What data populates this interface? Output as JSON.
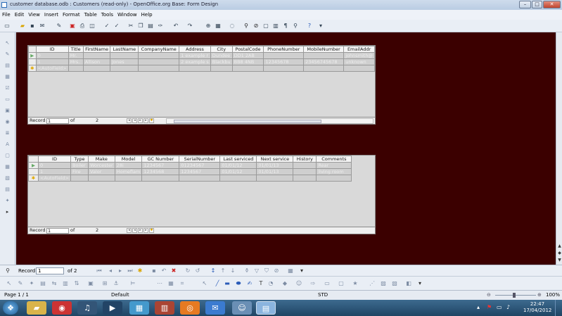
{
  "window": {
    "title": "customer database.odb : Customers (read-only) - OpenOffice.org Base: Form Design",
    "minimize": "–",
    "maximize": "□",
    "close": "✕"
  },
  "menu": [
    "File",
    "Edit",
    "View",
    "Insert",
    "Format",
    "Table",
    "Tools",
    "Window",
    "Help"
  ],
  "customers_grid": {
    "columns": [
      "ID",
      "Title",
      "FirstName",
      "LastName",
      "CompanyName",
      "Address",
      "City",
      "PostalCode",
      "PhoneNumber",
      "MobileNumber",
      "EmailAddr"
    ],
    "rows": [
      [
        "0",
        "Mr.",
        "",
        "",
        "",
        "1 example r",
        "Dundee",
        "DD1 2AB",
        "",
        "",
        "johnsmith@"
      ],
      [
        "1",
        "Mrs.",
        "Allison",
        "Jones",
        "",
        "2 example s",
        "Blackbu",
        "BB8 4NB",
        "12345678",
        "23456745678",
        "unknown"
      ]
    ],
    "new_row": "<AutoField>",
    "nav": {
      "label": "Record",
      "current": "1",
      "of_label": "of",
      "total": "2"
    }
  },
  "appliances_grid": {
    "columns": [
      "ID",
      "Type",
      "Make",
      "Model",
      "GC Number",
      "SerialNumber",
      "Last serviced",
      "Next service",
      "History",
      "Comments"
    ],
    "rows": [
      [
        "0",
        "Boiler",
        "Worcester",
        "28i",
        "1234567",
        "01234567",
        "01/01/12",
        "01/01/13",
        "",
        "Rear"
      ],
      [
        "1",
        "Fire",
        "Valor",
        "Homeflam",
        "1234568",
        "1234567",
        "01/01/12",
        "01/01/13",
        "",
        "living room"
      ]
    ],
    "new_row": "<AutoField>",
    "nav": {
      "label": "Record",
      "current": "1",
      "of_label": "of",
      "total": "2"
    }
  },
  "form_navigator": {
    "label": "Record",
    "current": "1",
    "of_label": "of 2"
  },
  "statusbar": {
    "page": "Page 1 / 1",
    "style": "Default",
    "mode": "STD",
    "zoom": "100%"
  },
  "taskbar": {
    "time": "22:47",
    "date": "17/04/2012"
  }
}
